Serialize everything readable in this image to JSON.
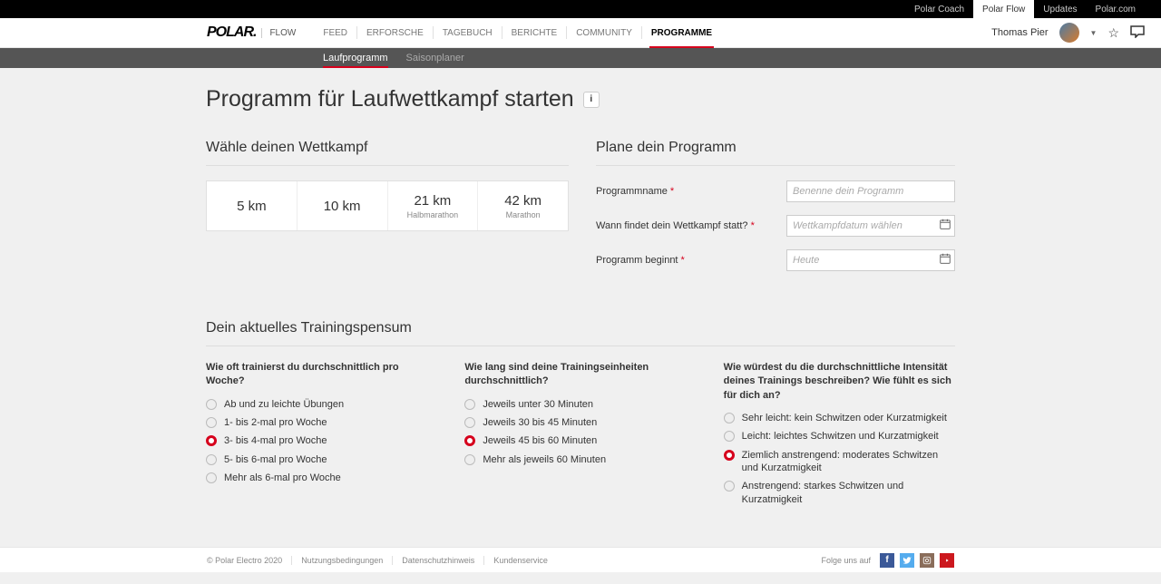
{
  "topbar": {
    "items": [
      "Polar Coach",
      "Polar Flow",
      "Updates",
      "Polar.com"
    ],
    "activeIndex": 1
  },
  "header": {
    "logo": "POLAR.",
    "flowLabel": "FLOW",
    "nav": [
      "FEED",
      "ERFORSCHE",
      "TAGEBUCH",
      "BERICHTE",
      "COMMUNITY",
      "PROGRAMME"
    ],
    "activeNav": 5,
    "username": "Thomas Pier"
  },
  "subbar": {
    "items": [
      "Laufprogramm",
      "Saisonplaner"
    ],
    "activeIndex": 0
  },
  "pageTitle": "Programm für Laufwettkampf starten",
  "chooseEvent": {
    "heading": "Wähle deinen Wettkampf",
    "items": [
      {
        "value": "5 km",
        "sub": ""
      },
      {
        "value": "10 km",
        "sub": ""
      },
      {
        "value": "21 km",
        "sub": "Halbmarathon"
      },
      {
        "value": "42 km",
        "sub": "Marathon"
      }
    ]
  },
  "planProgram": {
    "heading": "Plane dein Programm",
    "rows": [
      {
        "label": "Programmname",
        "placeholder": "Benenne dein Programm",
        "hasCal": false
      },
      {
        "label": "Wann findet dein Wettkampf statt?",
        "placeholder": "Wettkampfdatum wählen",
        "hasCal": true
      },
      {
        "label": "Programm beginnt",
        "placeholder": "Heute",
        "hasCal": true
      }
    ]
  },
  "training": {
    "heading": "Dein aktuelles Trainingspensum",
    "groups": [
      {
        "question": "Wie oft trainierst du durchschnittlich pro Woche?",
        "selected": 2,
        "options": [
          "Ab und zu leichte Übungen",
          "1- bis 2-mal pro Woche",
          "3- bis 4-mal pro Woche",
          "5- bis 6-mal pro Woche",
          "Mehr als 6-mal pro Woche"
        ]
      },
      {
        "question": "Wie lang sind deine Trainingseinheiten durchschnittlich?",
        "selected": 2,
        "options": [
          "Jeweils unter 30 Minuten",
          "Jeweils 30 bis 45 Minuten",
          "Jeweils 45 bis 60 Minuten",
          "Mehr als jeweils 60 Minuten"
        ]
      },
      {
        "question": "Wie würdest du die durchschnittliche Intensität deines Trainings beschreiben? Wie fühlt es sich für dich an?",
        "selected": 2,
        "options": [
          "Sehr leicht: kein Schwitzen oder Kurzatmigkeit",
          "Leicht: leichtes Schwitzen und Kurzatmigkeit",
          "Ziemlich anstrengend: moderates Schwitzen und Kurzatmigkeit",
          "Anstrengend: starkes Schwitzen und Kurzatmigkeit"
        ]
      }
    ]
  },
  "footer": {
    "copyright": "© Polar Electro 2020",
    "links": [
      "Nutzungsbedingungen",
      "Datenschutzhinweis",
      "Kundenservice"
    ],
    "followLabel": "Folge uns auf"
  }
}
